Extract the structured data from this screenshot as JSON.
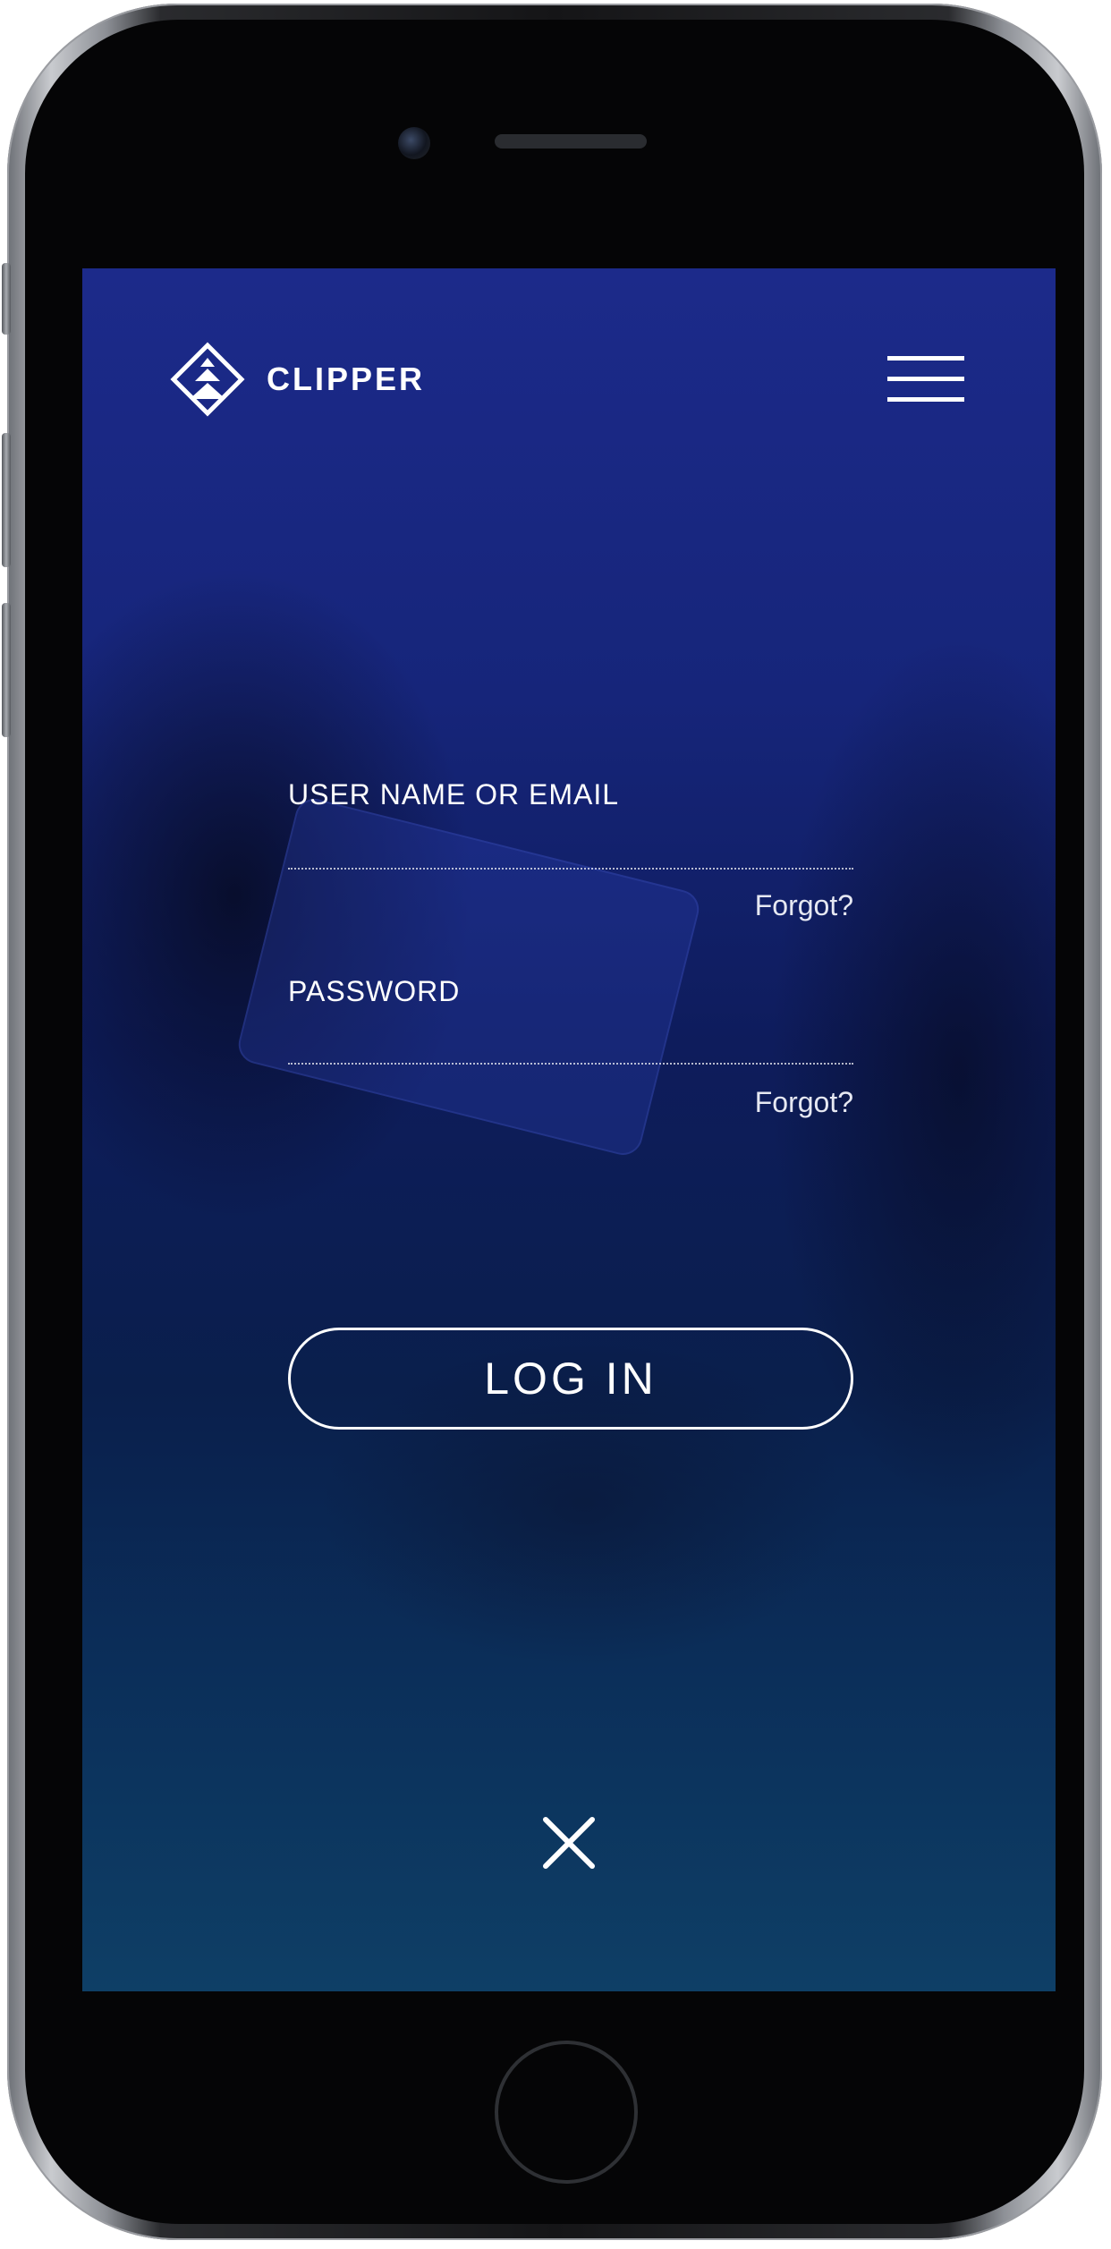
{
  "app": {
    "name": "CLIPPER"
  },
  "icons": {
    "logo": "clipper-logo-icon",
    "menu": "hamburger-menu-icon",
    "close": "close-icon"
  },
  "form": {
    "username_label": "USER NAME OR EMAIL",
    "username_value": "",
    "username_forgot": "Forgot?",
    "password_label": "PASSWORD",
    "password_value": "",
    "password_forgot": "Forgot?",
    "login_label": "LOG IN"
  },
  "colors": {
    "background_top": "#1c2a8a",
    "background_bottom": "#0e3f66",
    "text": "#ffffff"
  }
}
